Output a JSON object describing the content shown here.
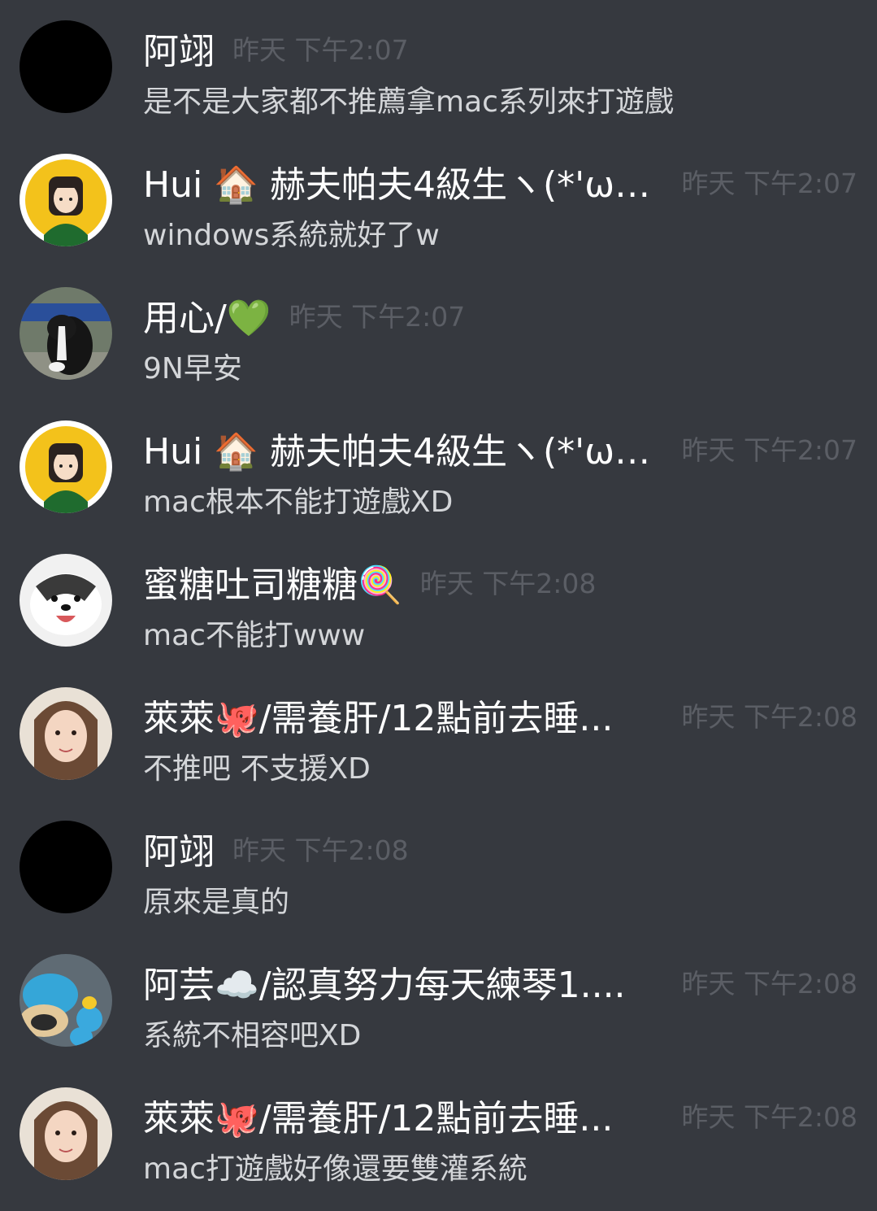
{
  "messages": [
    {
      "author": "阿翊",
      "time": "昨天 下午2:07",
      "text": "是不是大家都不推薦拿mac系列來打遊戲",
      "avatar": "black"
    },
    {
      "author": "Hui 🏠 赫夫帕夫4級生ヽ(*'ω'*...",
      "time": "昨天 下午2:07",
      "text": "windows系統就好了w",
      "avatar": "cartoon-girl"
    },
    {
      "author": "用心/💚",
      "time": "昨天 下午2:07",
      "text": "9N早安",
      "avatar": "border-collie"
    },
    {
      "author": "Hui 🏠 赫夫帕夫4級生ヽ(*'ω'*...",
      "time": "昨天 下午2:07",
      "text": "mac根本不能打遊戲XD",
      "avatar": "cartoon-girl"
    },
    {
      "author": "蜜糖吐司糖糖🍭",
      "time": "昨天 下午2:08",
      "text": "mac不能打www",
      "avatar": "husky"
    },
    {
      "author": "萊萊🐙/需養肝/12點前去睡...",
      "time": "昨天 下午2:08",
      "text": "不推吧 不支援XD",
      "avatar": "girl-photo"
    },
    {
      "author": "阿翊",
      "time": "昨天 下午2:08",
      "text": "原來是真的",
      "avatar": "black"
    },
    {
      "author": "阿芸☁️/認真努力每天練琴1....",
      "time": "昨天 下午2:08",
      "text": "系統不相容吧XD",
      "avatar": "plush-toys"
    },
    {
      "author": "萊萊🐙/需養肝/12點前去睡...",
      "time": "昨天 下午2:08",
      "text": "mac打遊戲好像還要雙灌系統",
      "avatar": "girl-photo"
    }
  ],
  "colors": {
    "background": "#36393f",
    "username": "#ffffff",
    "timestamp": "#5b5e65",
    "message_text": "#d4d6d9"
  }
}
